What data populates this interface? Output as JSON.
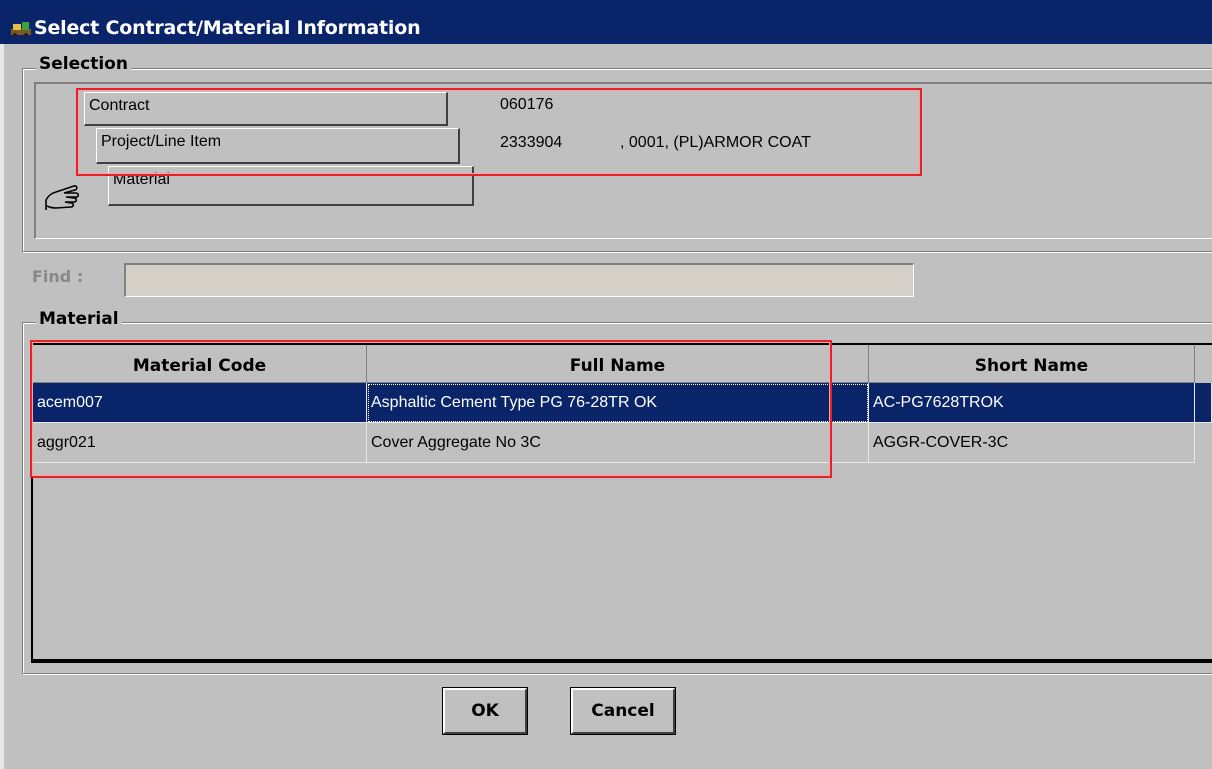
{
  "window": {
    "title": "Select Contract/Material Information",
    "icon": "app-icon"
  },
  "selection": {
    "group_label": "Selection",
    "contract_label": "Contract",
    "contract_value": "060176",
    "project_label": "Project/Line Item",
    "project_number": "2333904",
    "project_detail": ", 0001, (PL)ARMOR COAT",
    "material_label": "Material",
    "pointer_icon": "pointing-hand-icon"
  },
  "find": {
    "label": "Find :",
    "value": ""
  },
  "material": {
    "group_label": "Material",
    "columns": [
      "Material Code",
      "Full Name",
      "Short Name"
    ],
    "rows": [
      {
        "code": "acem007",
        "full_name": "Asphaltic Cement Type PG 76-28TR OK",
        "short_name": "AC-PG7628TROK",
        "selected": true
      },
      {
        "code": "aggr021",
        "full_name": "Cover Aggregate No 3C",
        "short_name": "AGGR-COVER-3C",
        "selected": false
      }
    ]
  },
  "buttons": {
    "ok": "OK",
    "cancel": "Cancel"
  },
  "colors": {
    "title_bar": "#0a246a",
    "selection_highlight": "#0a246a",
    "annotation_box": "#e8202a",
    "face": "#c0c0c0"
  }
}
